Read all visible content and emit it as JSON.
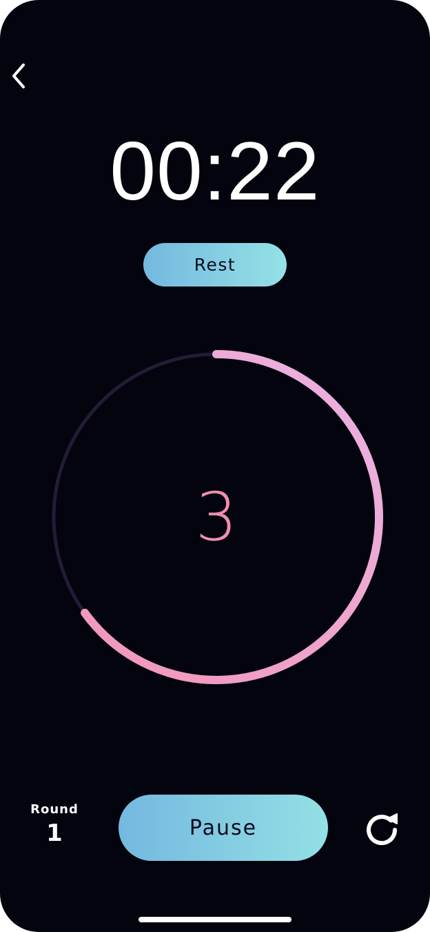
{
  "header": {
    "back_icon": "chevron-left-icon"
  },
  "timer": {
    "display": "00:22"
  },
  "phase": {
    "label": "Rest"
  },
  "countdown": {
    "value": "3",
    "progress": 0.65,
    "colors": {
      "track": "#221c35",
      "progress_start": "#f296b9",
      "progress_end": "#eab3e3"
    }
  },
  "round": {
    "label": "Round",
    "value": "1"
  },
  "controls": {
    "pause_label": "Pause",
    "reset_icon": "reset-icon"
  },
  "colors": {
    "background": "#04040f",
    "pill_gradient_start": "#74b8df",
    "pill_gradient_end": "#94e1e6",
    "count_text": "#ef8fb0"
  }
}
